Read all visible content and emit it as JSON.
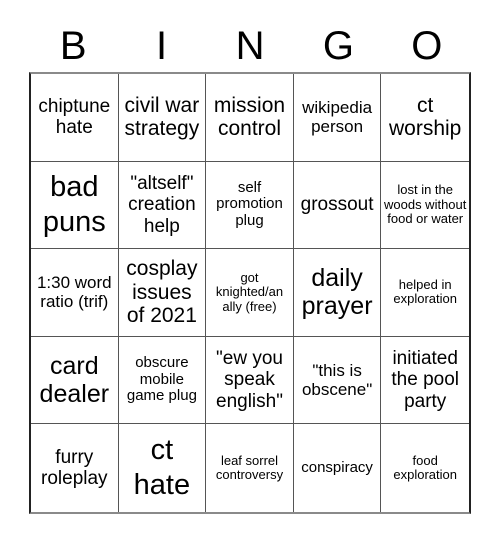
{
  "header": {
    "letters": [
      "B",
      "I",
      "N",
      "G",
      "O"
    ]
  },
  "cells": [
    "chiptune hate",
    "civil war strategy",
    "mission control",
    "wikipedia person",
    "ct worship",
    "bad puns",
    "\"altself\" creation help",
    "self promotion plug",
    "grossout",
    "lost in the woods without food or water",
    "1:30 word ratio (trif)",
    "cosplay issues of 2021",
    "got knighted/an ally (free)",
    "daily prayer",
    "helped in exploration",
    "card dealer",
    "obscure mobile game plug",
    "\"ew you speak english\"",
    "\"this is obscene\"",
    "initiated the pool party",
    "furry roleplay",
    "ct hate",
    "leaf sorrel controversy",
    "conspiracy",
    "food exploration"
  ]
}
